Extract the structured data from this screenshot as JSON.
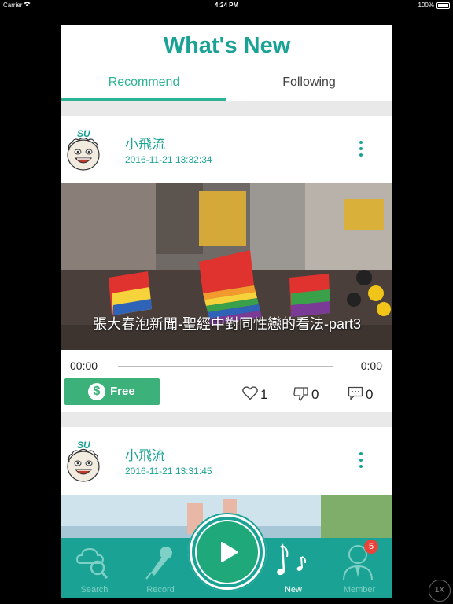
{
  "status_bar": {
    "carrier": "Carrier",
    "time": "4:24 PM",
    "battery": "100%"
  },
  "header": {
    "title": "What's New"
  },
  "tabs": [
    {
      "label": "Recommend",
      "active": true
    },
    {
      "label": "Following",
      "active": false
    }
  ],
  "posts": [
    {
      "author": "小飛流",
      "date": "2016-11-21 13:32:34",
      "caption": "張大春泡新聞-聖經中對同性戀的看法-part3",
      "time_current": "00:00",
      "time_total": "0:00",
      "price_label": "Free",
      "price_icon": "$",
      "likes": "1",
      "dislikes": "0",
      "comments": "0"
    },
    {
      "author": "小飛流",
      "date": "2016-11-21 13:31:45"
    }
  ],
  "tabbar": {
    "items": [
      {
        "label": "Search",
        "icon": "search-icon"
      },
      {
        "label": "Record",
        "icon": "microphone-icon"
      },
      {
        "label": "New",
        "icon": "music-note-icon",
        "active": true
      },
      {
        "label": "Member",
        "icon": "member-icon",
        "badge": "5"
      }
    ]
  },
  "speed_label": "1X",
  "colors": {
    "accent": "#1aa394",
    "free_button": "#3cb27a",
    "badge": "#e8443c"
  }
}
